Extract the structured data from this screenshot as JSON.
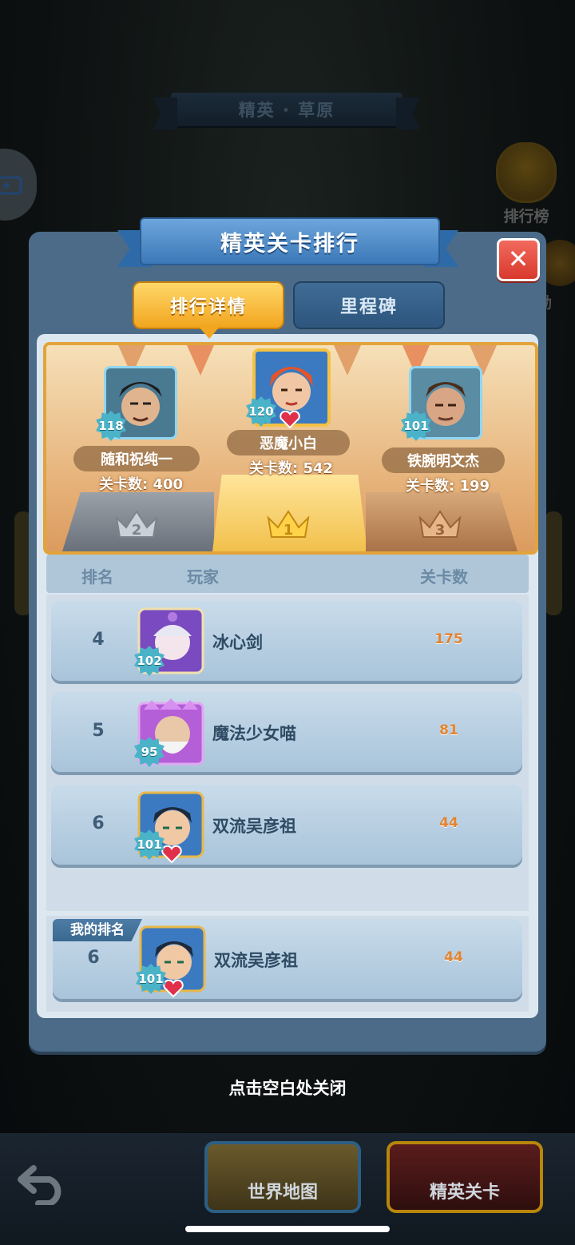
{
  "stage": {
    "title": "精英 · 草原"
  },
  "side": {
    "rank_label": "排行榜",
    "reward_label": "励"
  },
  "panel": {
    "title": "精英关卡排行",
    "close": "✕"
  },
  "tabs": [
    {
      "label": "排行详情",
      "active": true
    },
    {
      "label": "里程碑",
      "active": false
    }
  ],
  "podium": {
    "first": {
      "rank": "1",
      "level": "120",
      "name": "恶魔小白",
      "score": "关卡数: 542"
    },
    "second": {
      "rank": "2",
      "level": "118",
      "name": "随和祝纯一",
      "score": "关卡数: 400"
    },
    "third": {
      "rank": "3",
      "level": "101",
      "name": "铁腕明文杰",
      "score": "关卡数: 199"
    }
  },
  "list": {
    "headers": {
      "rank": "排名",
      "player": "玩家",
      "score": "关卡数"
    },
    "rows": [
      {
        "rank": "4",
        "level": "102",
        "name": "冰心剑",
        "score": "175"
      },
      {
        "rank": "5",
        "level": "95",
        "name": "魔法少女喵",
        "score": "81"
      },
      {
        "rank": "6",
        "level": "101",
        "name": "双流吴彦祖",
        "score": "44"
      }
    ]
  },
  "my_rank": {
    "tag": "我的排名",
    "rank": "6",
    "level": "101",
    "name": "双流吴彦祖",
    "score": "44"
  },
  "hint": "点击空白处关闭",
  "bottom": {
    "map_label": "世界地图",
    "elite_label": "精英关卡"
  },
  "colors": {
    "accent_gold": "#f2a51e",
    "panel_blue": "#4b6b88",
    "score_orange": "#e38430",
    "close_red": "#d8382c"
  }
}
